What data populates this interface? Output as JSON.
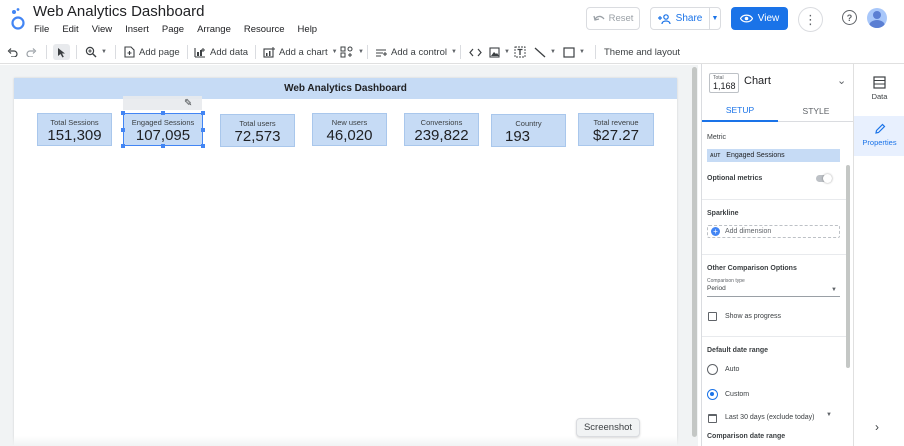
{
  "app": {
    "title": "Web Analytics Dashboard",
    "menu": [
      "File",
      "Edit",
      "View",
      "Insert",
      "Page",
      "Arrange",
      "Resource",
      "Help"
    ],
    "reset_label": "Reset",
    "share_label": "Share",
    "view_label": "View",
    "help_glyph": "?",
    "more_glyph": "⋮"
  },
  "toolbar": {
    "add_page": "Add page",
    "add_data": "Add data",
    "add_chart": "Add a chart",
    "add_control": "Add a control",
    "theme_layout": "Theme and layout"
  },
  "report": {
    "banner_title": "Web Analytics Dashboard",
    "scorecards": [
      {
        "label": "Total Sessions",
        "value": "151,309"
      },
      {
        "label": "Engaged Sessions",
        "value": "107,095"
      },
      {
        "label": "Total users",
        "value": "72,573"
      },
      {
        "label": "New users",
        "value": "46,020"
      },
      {
        "label": "Conversions",
        "value": "239,822"
      },
      {
        "label": "Country",
        "value": "193"
      },
      {
        "label": "Total revenue",
        "value": "$27.27"
      }
    ],
    "tooltip": "Screenshot"
  },
  "panel": {
    "thumb_label": "Total",
    "thumb_value": "1,168",
    "title": "Chart",
    "tab_setup": "SETUP",
    "tab_style": "STYLE",
    "metric_label": "Metric",
    "metric_prefix": "AUT",
    "metric_value": "Engaged Sessions",
    "optional_metrics": "Optional metrics",
    "sparkline_label": "Sparkline",
    "add_dimension": "Add dimension",
    "other_comparison": "Other Comparison Options",
    "comparison_type_label": "Comparison type",
    "comparison_type_value": "Period",
    "show_progress": "Show as progress",
    "default_date_range": "Default date range",
    "auto_label": "Auto",
    "custom_label": "Custom",
    "date_range_value": "Last 30 days (exclude today)",
    "comparison_date_range": "Comparison date range"
  },
  "rail": {
    "data_label": "Data",
    "properties_label": "Properties"
  },
  "colors": {
    "accent": "#1a73e8",
    "scorecard_bg": "#c6dbf5"
  }
}
